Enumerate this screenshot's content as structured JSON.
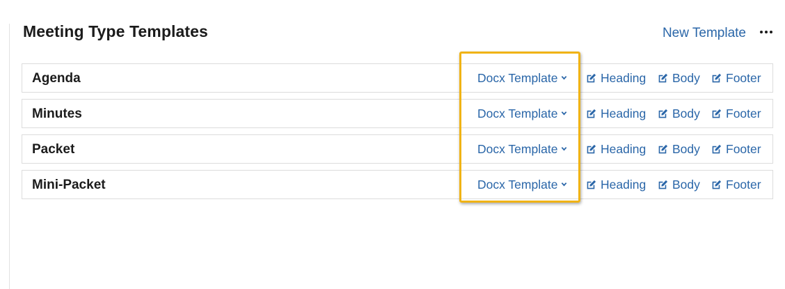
{
  "header": {
    "title": "Meeting Type Templates",
    "new_template_label": "New Template",
    "more_icon": "ellipsis-icon"
  },
  "rows": [
    {
      "name": "Agenda",
      "dropdown_label": "Docx Template",
      "heading_label": "Heading",
      "body_label": "Body",
      "footer_label": "Footer"
    },
    {
      "name": "Minutes",
      "dropdown_label": "Docx Template",
      "heading_label": "Heading",
      "body_label": "Body",
      "footer_label": "Footer"
    },
    {
      "name": "Packet",
      "dropdown_label": "Docx Template",
      "heading_label": "Heading",
      "body_label": "Body",
      "footer_label": "Footer"
    },
    {
      "name": "Mini-Packet",
      "dropdown_label": "Docx Template",
      "heading_label": "Heading",
      "body_label": "Body",
      "footer_label": "Footer"
    }
  ],
  "icons": {
    "edit": "edit-icon",
    "dropdown": "chevron-down-icon"
  },
  "colors": {
    "link": "#2a66a8",
    "highlight": "#f0b315",
    "text": "#1b1b1b",
    "row_border": "#dcdcdc"
  }
}
